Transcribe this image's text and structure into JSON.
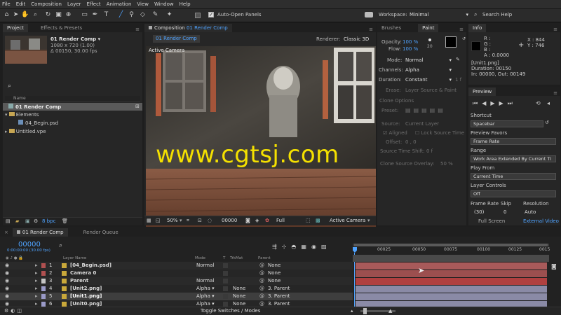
{
  "menu": [
    "File",
    "Edit",
    "Composition",
    "Layer",
    "Effect",
    "Animation",
    "View",
    "Window",
    "Help"
  ],
  "toolbar": {
    "auto_open_label": "Auto-Open Panels",
    "workspace_label": "Workspace:",
    "workspace_value": "Minimal",
    "search_placeholder": "Search Help"
  },
  "project": {
    "tabs": [
      "Project",
      "Effects & Presets"
    ],
    "comp_name": "01 Render Comp ▾",
    "comp_info1": "1080 x 720 (1.00)",
    "comp_info2": "Δ 00150, 30.00 fps",
    "search_icon": "search-icon",
    "column_name": "Name",
    "items": [
      {
        "label": "01 Render Comp",
        "indent": 0,
        "selected": true,
        "type": "comp"
      },
      {
        "label": "Elements",
        "indent": 0,
        "selected": false,
        "type": "folder"
      },
      {
        "label": "04_Begin.psd",
        "indent": 1,
        "selected": false,
        "type": "file"
      },
      {
        "label": "Untitled.vpe",
        "indent": 0,
        "selected": false,
        "type": "folder"
      }
    ],
    "bpc": "8 bpc"
  },
  "composition": {
    "tab_prefix": "Composition ",
    "tab_name": "01 Render Comp",
    "subtab": "01 Render Comp",
    "renderer_label": "Renderer:",
    "renderer_value": "Classic 3D",
    "active_camera_label": "Active Camera",
    "watermark": "www.cgtsj.com",
    "zoom": "50%",
    "time": "00000",
    "resolution": "Full",
    "view": "Active Camera"
  },
  "paint": {
    "tabs": [
      "Brushes",
      "Paint"
    ],
    "opacity_label": "Opacity:",
    "opacity_value": "100 %",
    "flow_label": "Flow:",
    "flow_value": "100 %",
    "brush_size": "20",
    "mode_label": "Mode:",
    "mode_value": "Normal",
    "channels_label": "Channels:",
    "channels_value": "Alpha",
    "duration_label": "Duration:",
    "duration_value": "Constant",
    "duration_frames": "1 f",
    "erase_label": "Erase:",
    "erase_value": "Layer Source & Paint",
    "clone_options": "Clone Options",
    "preset_label": "Preset:",
    "source_label": "Source:",
    "source_value": "Current Layer",
    "aligned": "Aligned",
    "lock_source": "Lock Source Time",
    "offset_label": "Offset:",
    "offset_value": "0 , 0",
    "shift_label": "Source Time Shift:",
    "shift_value": "0 f",
    "overlay_label": "Clone Source Overlay:",
    "overlay_value": "50 %"
  },
  "info": {
    "tab": "Info",
    "r": "R :",
    "g": "G :",
    "b": "B :",
    "a": "A : 0.0000",
    "x": "X : 844",
    "y": "Y : 746",
    "file": "[Unit1.png]",
    "duration": "Duration: 00150",
    "inout": "In: 00000, Out: 00149"
  },
  "preview": {
    "tab": "Preview",
    "shortcut_label": "Shortcut",
    "shortcut_value": "Spacebar",
    "favors_label": "Preview Favors",
    "favors_value": "Frame Rate",
    "range_label": "Range",
    "range_value": "Work Area Extended By Current Ti",
    "play_from_label": "Play From",
    "play_from_value": "Current Time",
    "layer_controls_label": "Layer Controls",
    "layer_controls_value": "Off",
    "frame_rate_label": "Frame Rate",
    "skip_label": "Skip",
    "resolution_label": "Resolution",
    "frame_rate_value": "(30)",
    "skip_value": "0",
    "resolution_value": "Auto",
    "full_screen": "Full Screen",
    "external_video": "External Video"
  },
  "timeline": {
    "tabs": [
      "01 Render Comp",
      "Render Queue"
    ],
    "time": "00000",
    "time_sub": "0:00:00:00 (30.00 fps)",
    "columns": {
      "layer_name": "Layer Name",
      "mode": "Mode",
      "t": "T",
      "trkmat": "TrkMat",
      "parent": "Parent"
    },
    "ruler": [
      "00025",
      "00050",
      "00075",
      "00100",
      "00125",
      "0015"
    ],
    "layers": [
      {
        "num": "1",
        "name": "[04_Begin.psd]",
        "color": "#b05050",
        "mode": "Normal",
        "trkmat": "",
        "parent": "None",
        "bar": "#a85a5a"
      },
      {
        "num": "2",
        "name": "Camera 0",
        "color": "#b05050",
        "mode": "",
        "trkmat": "",
        "parent": "None",
        "bar": "#9c4f4f"
      },
      {
        "num": "3",
        "name": "Parent",
        "color": "#c4c4c4",
        "mode": "Normal",
        "trkmat": "",
        "parent": "None",
        "bar": "#b04040"
      },
      {
        "num": "4",
        "name": "[Unit2.png]",
        "color": "#9a9ac8",
        "mode": "Alpha ▾",
        "trkmat": "None",
        "parent": "3. Parent",
        "bar": "#8a8aa6"
      },
      {
        "num": "5",
        "name": "[Unit1.png]",
        "color": "#9a9ac8",
        "mode": "Alpha ▾",
        "trkmat": "None",
        "parent": "3. Parent",
        "bar": "#8a8aa6"
      },
      {
        "num": "6",
        "name": "[Unit0.png]",
        "color": "#9a9ac8",
        "mode": "Alpha ▾",
        "trkmat": "None",
        "parent": "3. Parent",
        "bar": "#8a8aa6"
      }
    ],
    "toggle": "Toggle Switches / Modes"
  }
}
